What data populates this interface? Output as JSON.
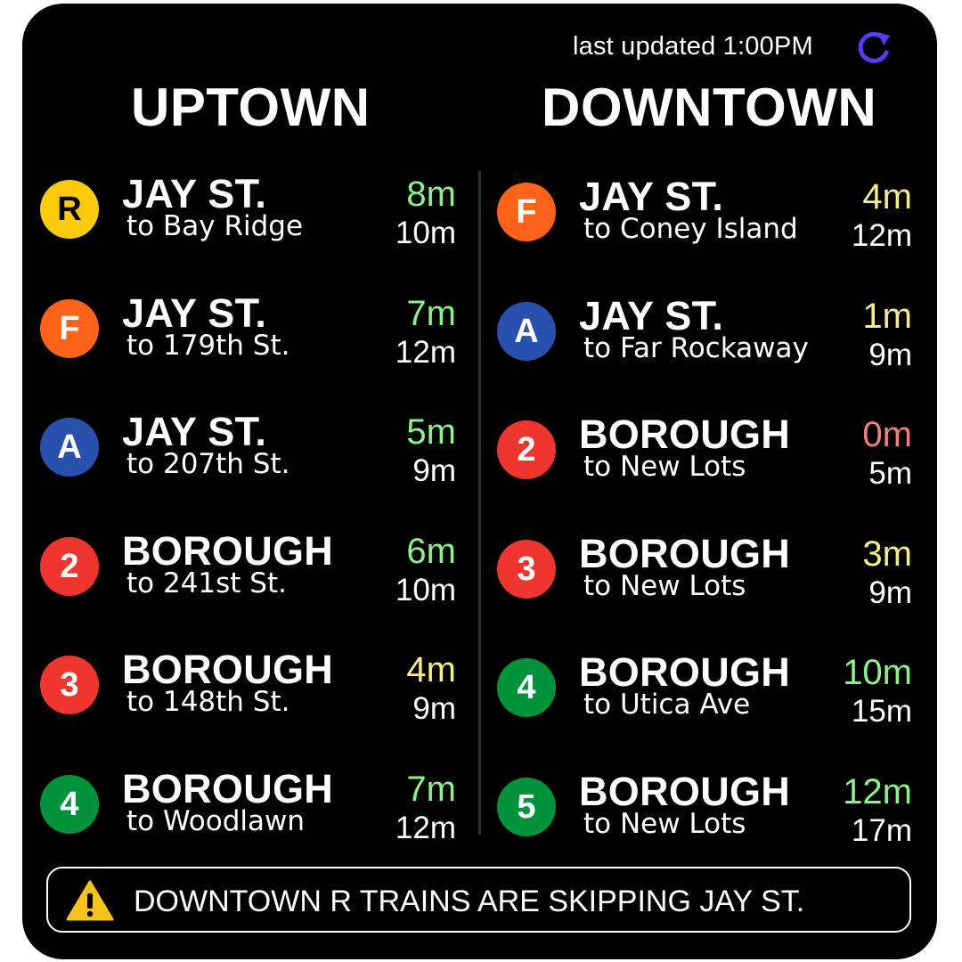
{
  "header": {
    "last_updated": "last updated 1:00PM",
    "refresh_icon": "refresh-icon"
  },
  "columns": [
    {
      "title": "UPTOWN",
      "rows": [
        {
          "line": "R",
          "line_color": "#FCCC0A",
          "line_text_color": "#000000",
          "station": "JAY ST.",
          "dest": "to Bay Ridge",
          "next": "8m",
          "next_color": "#8EF28A",
          "after": "10m"
        },
        {
          "line": "F",
          "line_color": "#FF6319",
          "line_text_color": "#FFFFFF",
          "station": "JAY ST.",
          "dest": "to 179th St.",
          "next": "7m",
          "next_color": "#8EF28A",
          "after": "12m"
        },
        {
          "line": "A",
          "line_color": "#2850AD",
          "line_text_color": "#FFFFFF",
          "station": "JAY ST.",
          "dest": "to 207th St.",
          "next": "5m",
          "next_color": "#8EF28A",
          "after": "9m"
        },
        {
          "line": "2",
          "line_color": "#EE352E",
          "line_text_color": "#FFFFFF",
          "station": "BOROUGH",
          "dest": "to 241st St.",
          "next": "6m",
          "next_color": "#8EF28A",
          "after": "10m"
        },
        {
          "line": "3",
          "line_color": "#EE352E",
          "line_text_color": "#FFFFFF",
          "station": "BOROUGH",
          "dest": "to 148th St.",
          "next": "4m",
          "next_color": "#F5EE8A",
          "after": "9m"
        },
        {
          "line": "4",
          "line_color": "#00933C",
          "line_text_color": "#FFFFFF",
          "station": "BOROUGH",
          "dest": "to Woodlawn",
          "next": "7m",
          "next_color": "#8EF28A",
          "after": "12m"
        }
      ]
    },
    {
      "title": "DOWNTOWN",
      "rows": [
        {
          "line": "F",
          "line_color": "#FF6319",
          "line_text_color": "#FFFFFF",
          "station": "JAY ST.",
          "dest": "to Coney Island",
          "next": "4m",
          "next_color": "#F5EE8A",
          "after": "12m"
        },
        {
          "line": "A",
          "line_color": "#2850AD",
          "line_text_color": "#FFFFFF",
          "station": "JAY ST.",
          "dest": "to Far Rockaway",
          "next": "1m",
          "next_color": "#F5EE8A",
          "after": "9m"
        },
        {
          "line": "2",
          "line_color": "#EE352E",
          "line_text_color": "#FFFFFF",
          "station": "BOROUGH",
          "dest": "to New Lots",
          "next": "0m",
          "next_color": "#F08080",
          "after": "5m"
        },
        {
          "line": "3",
          "line_color": "#EE352E",
          "line_text_color": "#FFFFFF",
          "station": "BOROUGH",
          "dest": "to New Lots",
          "next": "3m",
          "next_color": "#F5EE8A",
          "after": "9m"
        },
        {
          "line": "4",
          "line_color": "#00933C",
          "line_text_color": "#FFFFFF",
          "station": "BOROUGH",
          "dest": "to Utica Ave",
          "next": "10m",
          "next_color": "#8EF28A",
          "after": "15m"
        },
        {
          "line": "5",
          "line_color": "#00933C",
          "line_text_color": "#FFFFFF",
          "station": "BOROUGH",
          "dest": "to New Lots",
          "next": "12m",
          "next_color": "#8EF28A",
          "after": "17m"
        }
      ]
    }
  ],
  "alert": {
    "icon": "warning-icon",
    "icon_color": "#F7C31B",
    "text": "DOWNTOWN R TRAINS ARE SKIPPING JAY ST."
  },
  "colors": {
    "background": "#000000",
    "refresh_icon": "#5B3CF0"
  }
}
